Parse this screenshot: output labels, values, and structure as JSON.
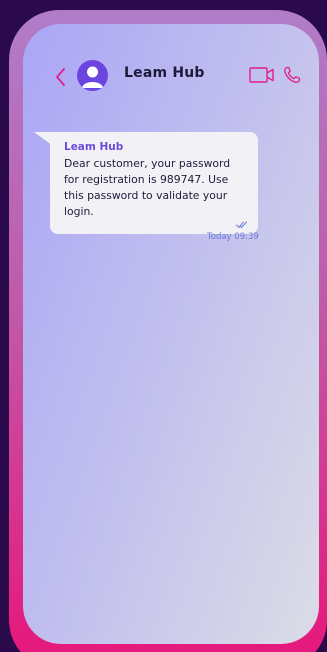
{
  "header": {
    "contact_name": "Leam Hub",
    "back_icon": "chevron-left-icon",
    "avatar_icon": "user-avatar-icon",
    "video_icon": "video-camera-icon",
    "call_icon": "phone-icon"
  },
  "message": {
    "sender": "Leam Hub",
    "text": "Dear customer, your password for registration is 989747. Use this password to validate your login.",
    "status_icon": "double-check-icon",
    "timestamp": "Today 09:39"
  },
  "colors": {
    "accent": "#e0208a",
    "avatar": "#6b45e0",
    "sender": "#6a4ad8",
    "timestamp": "#6a78d8",
    "bubble": "#f2f2f6"
  }
}
